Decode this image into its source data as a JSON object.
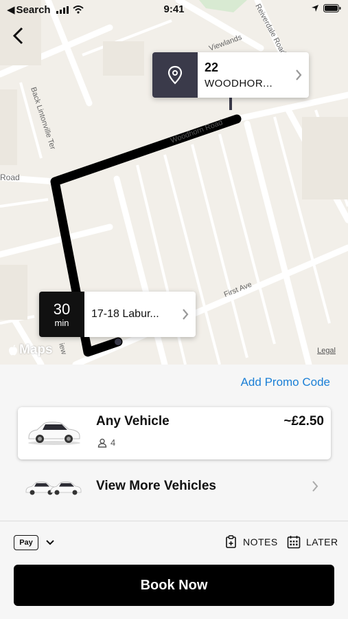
{
  "status_bar": {
    "back_app": "Search",
    "time": "9:41"
  },
  "map": {
    "street_labels": {
      "viewlands": "Viewlands",
      "reiverdale": "Reiverdale Road",
      "back_lintonville": "Back Lintonville Ter",
      "woodhorn": "Woodhorn Road",
      "road_left": "Road",
      "first_ave": "First Ave",
      "view_partial": "iew"
    },
    "destination_pin": {
      "line1": "22",
      "line2": "WOODHOR..."
    },
    "origin_pin": {
      "eta_value": "30",
      "eta_unit": "min",
      "address": "17-18 Labur..."
    },
    "attribution": "Maps",
    "legal": "Legal"
  },
  "sheet": {
    "promo": "Add Promo Code",
    "vehicle": {
      "name": "Any Vehicle",
      "capacity": "4",
      "price": "~£2.50"
    },
    "more_vehicles": "View More Vehicles",
    "payment": "Pay",
    "notes": "NOTES",
    "later": "LATER",
    "book": "Book Now"
  },
  "colors": {
    "accent": "#1a7fd6",
    "pin_dark": "#3a3a4a",
    "route": "#000000"
  }
}
